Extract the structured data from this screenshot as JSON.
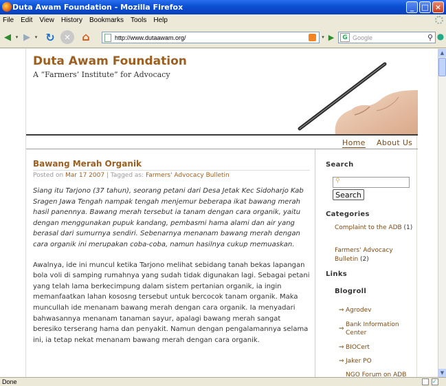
{
  "window": {
    "title": "Duta Awam Foundation - Mozilla Firefox"
  },
  "menu": {
    "items": [
      "File",
      "Edit",
      "View",
      "History",
      "Bookmarks",
      "Tools",
      "Help"
    ]
  },
  "toolbar": {
    "url": "http://www.dutaawam.org/",
    "search_placeholder": "Google"
  },
  "status": {
    "text": "Done"
  },
  "site": {
    "title": "Duta Awam Foundation",
    "tagline": "A “Farmers’ Institute” for Advocacy",
    "nav": {
      "home": "Home",
      "about": "About Us"
    }
  },
  "post": {
    "title": "Bawang Merah Organik",
    "meta_prefix": "Posted on ",
    "date": "Mar 17 2007",
    "meta_mid": " | Tagged as: ",
    "tag": "Farmers' Advocacy Bulletin",
    "para1": "Siang itu Tarjono (37 tahun), seorang petani dari Desa Jetak Kec Sidoharjo Kab Sragen Jawa Tengah nampak tengah menjemur beberapa ikat bawang merah hasil panennya. Bawang merah tersebut ia tanam dengan cara organik, yaitu dengan menggunakan pupuk kandang, pembasmi hama alami dan air yang berasal dari sumurnya sendiri. Sebenarnya menanam bawang merah dengan cara organik ini merupakan coba-coba, namun hasilnya cukup memuaskan.",
    "para2": "Awalnya, ide ini muncul ketika Tarjono melihat sebidang tanah bekas lapangan bola voli di samping rumahnya yang sudah tidak digunakan lagi. Sebagai petani yang telah lama berkecimpung dalam sistem pertanian organik, ia ingin memanfaatkan lahan kososng tersebut untuk bercocok tanam organik. Maka muncullah ide menanam bawang merah dengan cara organik. Ia menyadari bahwasannya menanam tanaman sayur, apalagi bawang merah sangat beresiko terserang hama dan penyakit. Namun dengan pengalamannya selama ini, ia tetap nekat menanam bawang merah dengan cara organik."
  },
  "sidebar": {
    "search_heading": "Search",
    "search_button": "Search",
    "categories_heading": "Categories",
    "categories": [
      {
        "label": "Complaint to the ADB",
        "count": "(1)"
      },
      {
        "label": "Farmers' Advocacy Bulletin",
        "count": "(2)"
      }
    ],
    "links_heading": "Links",
    "blogroll_heading": "Blogroll",
    "blogroll": [
      "Agrodev",
      "Bank Information Center",
      "BIOCert",
      "Jaker PO",
      "NGO Forum on ADB"
    ]
  }
}
